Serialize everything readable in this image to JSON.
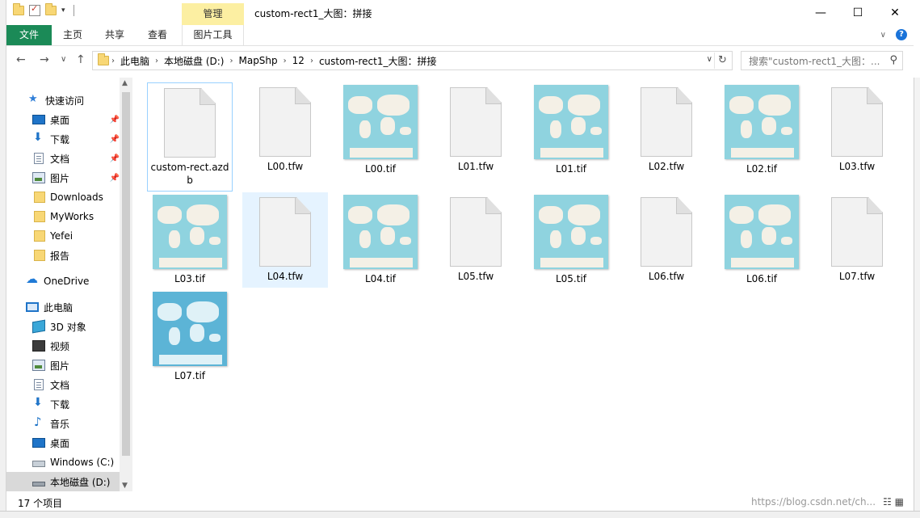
{
  "window": {
    "title": "custom-rect1_大图：拼接",
    "contextual_tab_group": "管理",
    "controls": {
      "minimize": "—",
      "maximize": "☐",
      "close": "✕"
    }
  },
  "ribbon": {
    "tabs": [
      {
        "label": "文件"
      },
      {
        "label": "主页"
      },
      {
        "label": "共享"
      },
      {
        "label": "查看"
      },
      {
        "label": "图片工具"
      }
    ]
  },
  "navigation": {
    "back": "←",
    "forward": "→",
    "recent": "∨",
    "up": "↑"
  },
  "address": {
    "crumbs": [
      "此电脑",
      "本地磁盘 (D:)",
      "MapShp",
      "12",
      "custom-rect1_大图：拼接"
    ],
    "search_placeholder": "搜索\"custom-rect1_大图：...",
    "refresh": "↻",
    "dropdown": "∨"
  },
  "sidebar": {
    "items": [
      {
        "label": "快速访问"
      },
      {
        "label": "桌面"
      },
      {
        "label": "下载"
      },
      {
        "label": "文档"
      },
      {
        "label": "图片"
      },
      {
        "label": "Downloads"
      },
      {
        "label": "MyWorks"
      },
      {
        "label": "Yefei"
      },
      {
        "label": "报告"
      },
      {
        "label": "OneDrive"
      },
      {
        "label": "此电脑"
      },
      {
        "label": "3D 对象"
      },
      {
        "label": "视频"
      },
      {
        "label": "图片"
      },
      {
        "label": "文档"
      },
      {
        "label": "下载"
      },
      {
        "label": "音乐"
      },
      {
        "label": "桌面"
      },
      {
        "label": "Windows (C:)"
      },
      {
        "label": "本地磁盘 (D:)"
      }
    ]
  },
  "files": [
    {
      "name": "custom-rect.azdb",
      "kind": "blank"
    },
    {
      "name": "L00.tfw",
      "kind": "blank"
    },
    {
      "name": "L00.tif",
      "kind": "map"
    },
    {
      "name": "L01.tfw",
      "kind": "blank"
    },
    {
      "name": "L01.tif",
      "kind": "map"
    },
    {
      "name": "L02.tfw",
      "kind": "blank"
    },
    {
      "name": "L02.tif",
      "kind": "map"
    },
    {
      "name": "L03.tfw",
      "kind": "blank"
    },
    {
      "name": "L03.tif",
      "kind": "map"
    },
    {
      "name": "L04.tfw",
      "kind": "blank"
    },
    {
      "name": "L04.tif",
      "kind": "map"
    },
    {
      "name": "L05.tfw",
      "kind": "blank"
    },
    {
      "name": "L05.tif",
      "kind": "map"
    },
    {
      "name": "L06.tfw",
      "kind": "blank"
    },
    {
      "name": "L06.tif",
      "kind": "map"
    },
    {
      "name": "L07.tfw",
      "kind": "blank"
    },
    {
      "name": "L07.tif",
      "kind": "map-dark"
    }
  ],
  "status": {
    "item_count": "17 个项目",
    "watermark": "https://blog.csdn.net/ch..."
  },
  "colors": {
    "file_tab": "#1b8a57",
    "manage_tab": "#fcefa2",
    "selection": "#e5f3ff",
    "map_water": "#8fd3df",
    "map_land": "#f4f0e6"
  }
}
